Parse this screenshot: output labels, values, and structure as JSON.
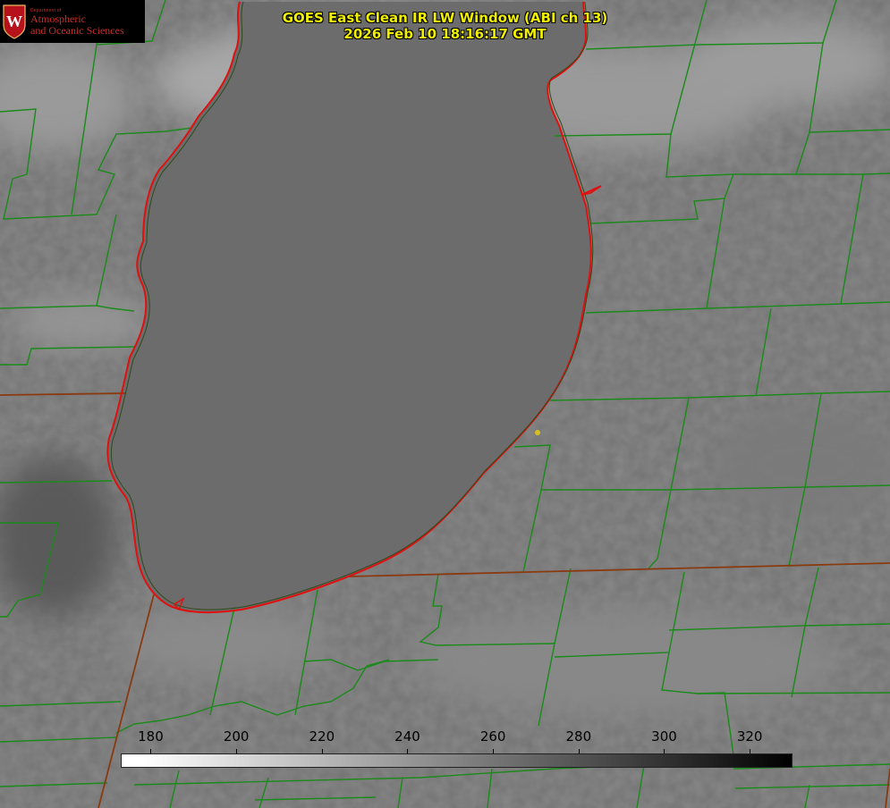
{
  "logo": {
    "dept": "Department of",
    "line1": "Atmospheric",
    "line2": "and Oceanic Sciences",
    "crest_letter": "W",
    "crest_color": "#b5121b"
  },
  "title": {
    "line1": "GOES East Clean IR LW Window (ABI ch 13)",
    "line2": "2026 Feb 10 18:16:17 GMT"
  },
  "colorbar": {
    "ticks": [
      "180",
      "200",
      "220",
      "240",
      "260",
      "280",
      "300",
      "320"
    ],
    "min": 173,
    "max": 330
  },
  "colors": {
    "title": "#f0f000",
    "county_lines": "#1a8a1a",
    "state_lines": "#8a3a10",
    "lake_shore": "#e01010",
    "station_marker": "#d8c020"
  }
}
